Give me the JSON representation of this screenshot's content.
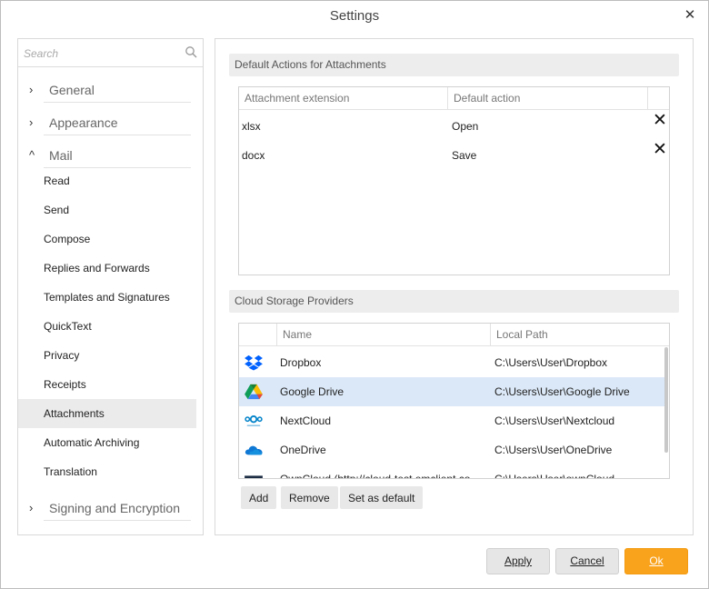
{
  "window": {
    "title": "Settings",
    "close_glyph": "✕"
  },
  "sidebar": {
    "search_placeholder": "Search",
    "sections": {
      "general": {
        "label": "General",
        "chevron": "›"
      },
      "appearance": {
        "label": "Appearance",
        "chevron": "›"
      },
      "mail": {
        "label": "Mail",
        "chevron": "^"
      },
      "signing": {
        "label": "Signing and Encryption",
        "chevron": "›"
      }
    },
    "mail_items": [
      "Read",
      "Send",
      "Compose",
      "Replies and Forwards",
      "Templates and Signatures",
      "QuickText",
      "Privacy",
      "Receipts",
      "Attachments",
      "Automatic Archiving",
      "Translation"
    ],
    "selected_item": "Attachments"
  },
  "attachments": {
    "header": "Default Actions for Attachments",
    "columns": [
      "Attachment extension",
      "Default action"
    ],
    "rows": [
      {
        "extension": "xlsx",
        "action": "Open",
        "delete_glyph": "✕"
      },
      {
        "extension": "docx",
        "action": "Save",
        "delete_glyph": "✕"
      }
    ]
  },
  "cloud": {
    "header": "Cloud Storage Providers",
    "columns": [
      "Name",
      "Local Path"
    ],
    "rows": [
      {
        "name": "Dropbox",
        "path": "C:\\Users\\User\\Dropbox",
        "icon": "dropbox-icon"
      },
      {
        "name": "Google Drive",
        "path": "C:\\Users\\User\\Google Drive",
        "icon": "google-drive-icon",
        "selected": true
      },
      {
        "name": "NextCloud",
        "path": "C:\\Users\\User\\Nextcloud",
        "icon": "nextcloud-icon"
      },
      {
        "name": "OneDrive",
        "path": "C:\\Users\\User\\OneDrive",
        "icon": "onedrive-icon"
      },
      {
        "name": "OwnCloud (http://cloud-test.emclient.co",
        "path": "C:\\Users\\User\\ownCloud",
        "icon": "owncloud-icon"
      }
    ],
    "buttons": {
      "add": "Add",
      "remove": "Remove",
      "set_default": "Set as default"
    }
  },
  "footer": {
    "apply": "Apply",
    "cancel": "Cancel",
    "ok": "Ok"
  },
  "colors": {
    "accent": "#f9a21b",
    "selection": "#dbe8f7",
    "sidebar_selection": "#ebebeb"
  }
}
